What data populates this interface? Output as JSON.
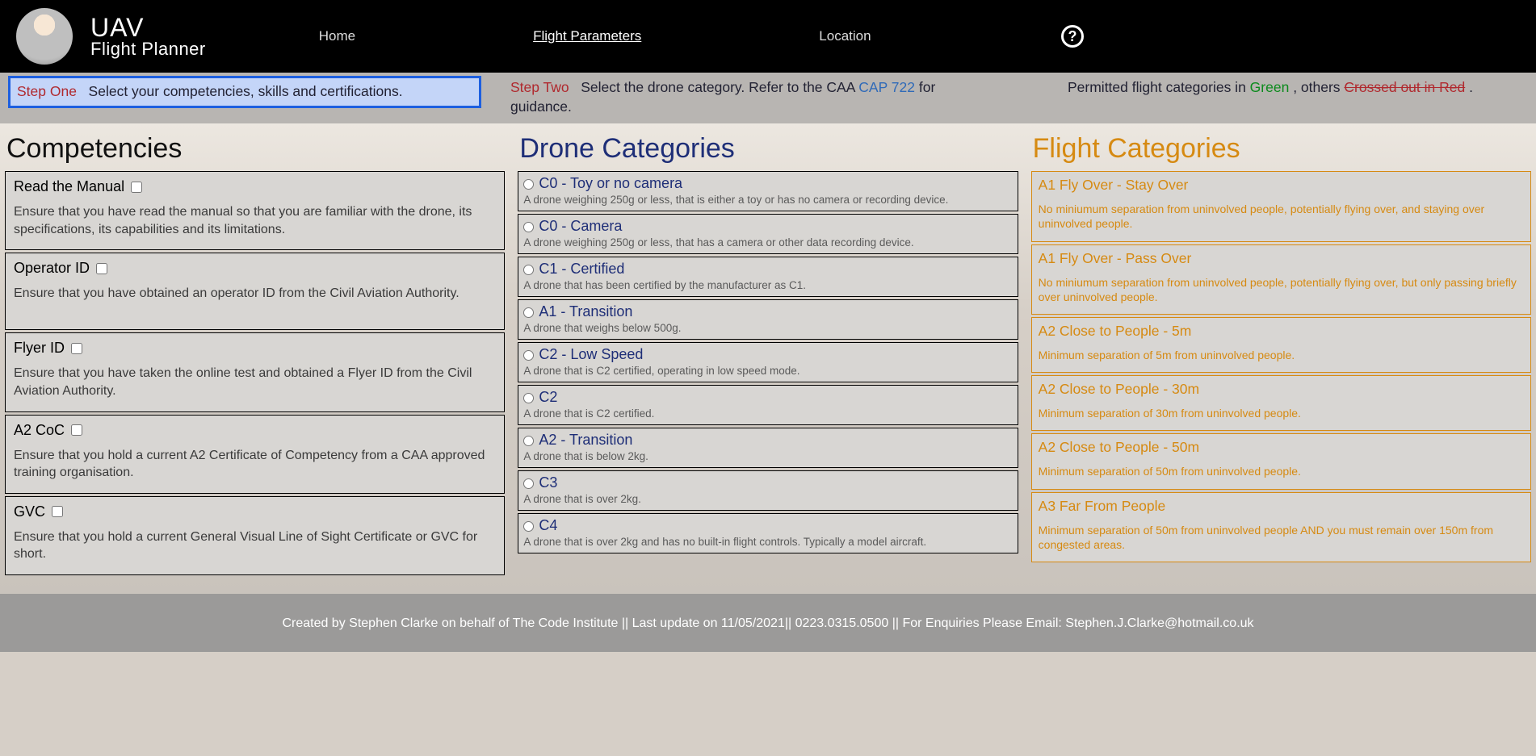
{
  "brand": {
    "title": "UAV",
    "subtitle": "Flight Planner"
  },
  "nav": {
    "home": "Home",
    "flight_params": "Flight Parameters",
    "location": "Location",
    "help_glyph": "?"
  },
  "steps": {
    "one_label": "Step One",
    "one_text": "Select your competencies, skills and certifications.",
    "two_label": "Step Two",
    "two_text_pre": "Select the drone category. Refer to the CAA ",
    "two_cap": "CAP 722",
    "two_text_post": " for guidance.",
    "three_pre": "Permitted flight categories in ",
    "three_green": "Green",
    "three_mid": ", others ",
    "three_redstrike": "Crossed out in Red",
    "three_post": "."
  },
  "columns": {
    "competencies_title": "Competencies",
    "drones_title": "Drone Categories",
    "flightcats_title": "Flight Categories"
  },
  "competencies": [
    {
      "label": "Read the Manual",
      "desc": "Ensure that you have read the manual so that you are familiar with the drone, its specifications, its capabilities and its limitations."
    },
    {
      "label": "Operator ID",
      "desc": "Ensure that you have obtained an operator ID from the Civil Aviation Authority."
    },
    {
      "label": "Flyer ID",
      "desc": "Ensure that you have taken the online test and obtained a Flyer ID from the Civil Aviation Authority."
    },
    {
      "label": "A2 CoC",
      "desc": "Ensure that you hold a current A2 Certificate of Competency from a CAA approved training organisation."
    },
    {
      "label": "GVC",
      "desc": "Ensure that you hold a current General Visual Line of Sight Certificate or GVC for short."
    }
  ],
  "drones": [
    {
      "label": "C0 - Toy or no camera",
      "desc": "A drone weighing 250g or less, that is either a toy or has no camera or recording device."
    },
    {
      "label": "C0 - Camera",
      "desc": "A drone weighing 250g or less, that has a camera or other data recording device."
    },
    {
      "label": "C1 - Certified",
      "desc": "A drone that has been certified by the manufacturer as C1."
    },
    {
      "label": "A1 - Transition",
      "desc": "A drone that weighs below 500g."
    },
    {
      "label": "C2 - Low Speed",
      "desc": "A drone that is C2 certified, operating in low speed mode."
    },
    {
      "label": "C2",
      "desc": "A drone that is C2 certified."
    },
    {
      "label": "A2 - Transition",
      "desc": "A drone that is below 2kg."
    },
    {
      "label": "C3",
      "desc": "A drone that is over 2kg."
    },
    {
      "label": "C4",
      "desc": "A drone that is over 2kg and has no built-in flight controls. Typically a model aircraft."
    }
  ],
  "flightcats": [
    {
      "label": "A1 Fly Over - Stay Over",
      "desc": "No miniumum separation from uninvolved people, potentially flying over, and staying over uninvolved people."
    },
    {
      "label": "A1 Fly Over - Pass Over",
      "desc": "No miniumum separation from uninvolved people, potentially flying over, but only passing briefly over uninvolved people."
    },
    {
      "label": "A2 Close to People - 5m",
      "desc": "Minimum separation of 5m from uninvolved people."
    },
    {
      "label": "A2 Close to People - 30m",
      "desc": "Minimum separation of 30m from uninvolved people."
    },
    {
      "label": "A2 Close to People - 50m",
      "desc": "Minimum separation of 50m from uninvolved people."
    },
    {
      "label": "A3 Far From People",
      "desc": "Minimum separation of 50m from uninvolved people AND you must remain over 150m from congested areas."
    }
  ],
  "footer": "Created by Stephen Clarke on behalf of The Code Institute || Last update on 11/05/2021|| 0223.0315.0500 || For Enquiries Please Email: Stephen.J.Clarke@hotmail.co.uk"
}
